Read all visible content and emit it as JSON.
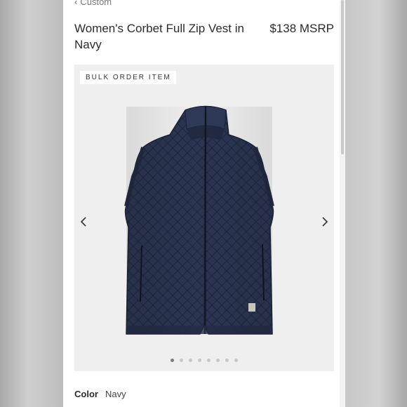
{
  "breadcrumb": {
    "label": "Custom"
  },
  "product": {
    "title": "Women's Corbet Full Zip Vest in Navy",
    "price": "$138 MSRP"
  },
  "gallery": {
    "badge": "BULK ORDER ITEM",
    "image_name": "navy-quilted-vest",
    "dot_count": 8,
    "active_dot_index": 0,
    "prev_icon": "chevron-left-icon",
    "next_icon": "chevron-right-icon"
  },
  "color": {
    "label": "Color",
    "value": "Navy"
  },
  "colors": {
    "vest": "#2b3550",
    "panel": "#ffffff",
    "gallery_bg": "#efefef"
  }
}
